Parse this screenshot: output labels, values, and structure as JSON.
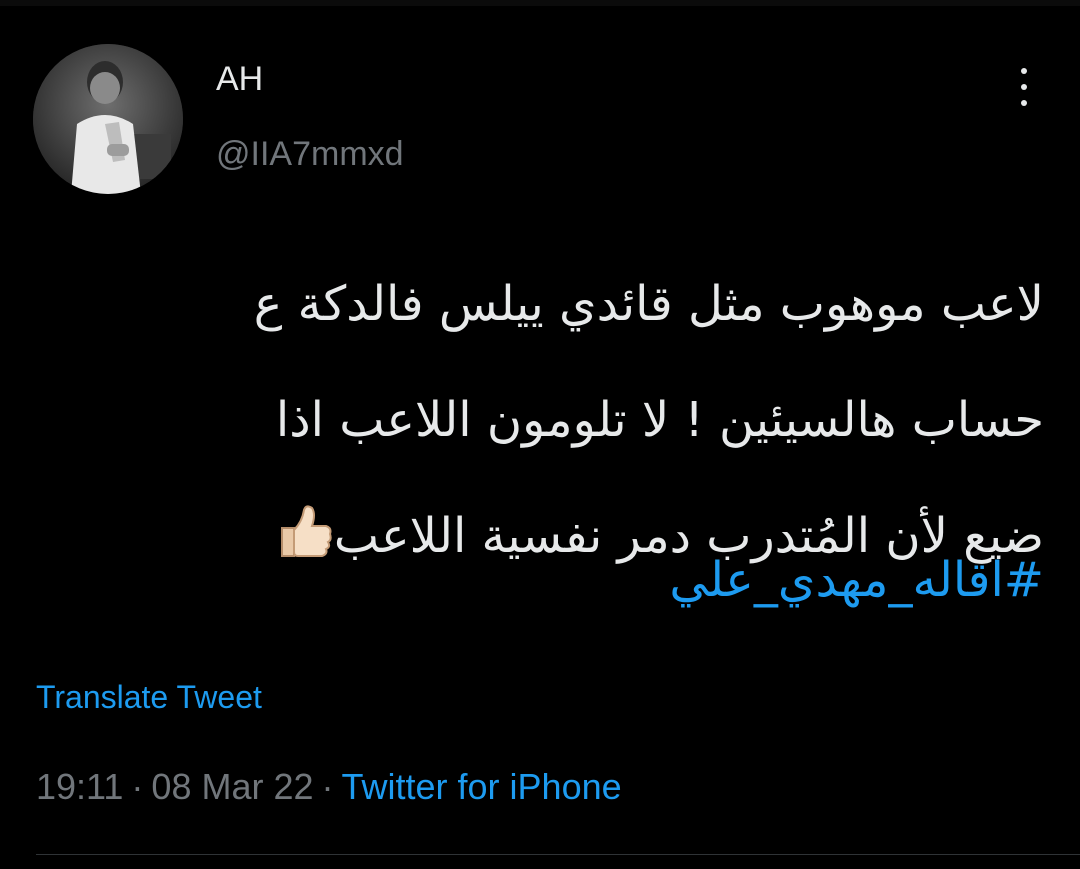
{
  "author": {
    "display_name": "AH",
    "handle": "@IIA7mmxd"
  },
  "tweet": {
    "lines": [
      "لاعب موهوب مثل قائدي ييلس فالدكة ع",
      "حساب هالسيئين ! لا تلومون اللاعب اذا",
      "ضيع لأن المُتدرب دمر نفسية اللاعب"
    ],
    "emoji": "thumbs-up-icon",
    "hashtag": "#اقاله_مهدي_علي"
  },
  "translate_label": "Translate Tweet",
  "meta": {
    "time": "19:11",
    "separator": "·",
    "date": "08 Mar 22",
    "source": "Twitter for iPhone"
  },
  "colors": {
    "background": "#000000",
    "text": "#e7e9ea",
    "muted": "#71767b",
    "accent": "#1d9bf0"
  }
}
